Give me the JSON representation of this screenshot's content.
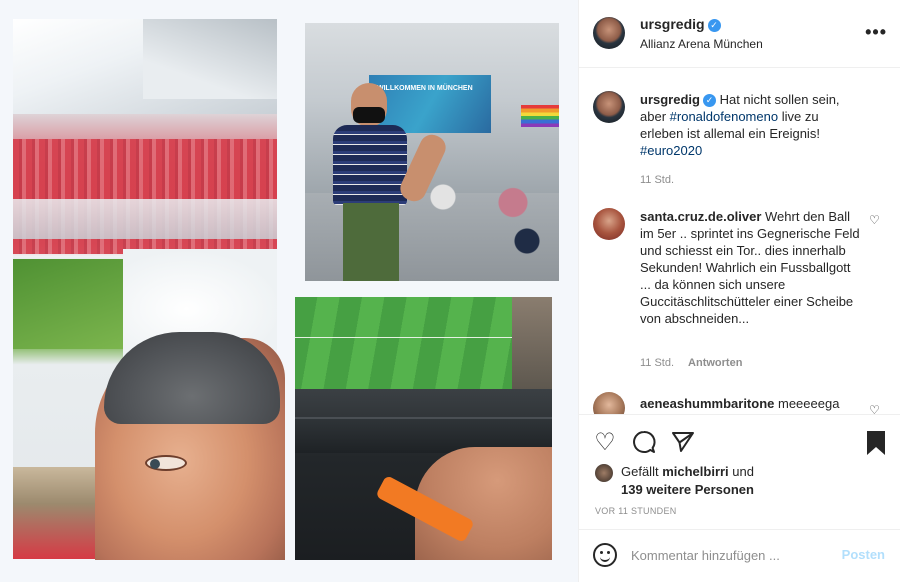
{
  "post": {
    "author": "ursgredig",
    "location": "Allianz Arena München",
    "more_icon": "more-horizontal-icon"
  },
  "caption": {
    "author": "ursgredig",
    "text_before": "Hat nicht sollen sein, aber",
    "mention": "#ronaldofenomeno",
    "text_after": "live zu erleben ist allemal ein Ereignis!",
    "hashtag": "#euro2020",
    "time": "11 Std."
  },
  "comments": [
    {
      "author": "santa.cruz.de.oliver",
      "text": "Wehrt den Ball im 5er .. sprintet ins Gegnerische Feld und schiesst ein Tor.. dies innerhalb Sekunden! Wahrlich ein Fussballgott ... da können sich unsere Guccitäschlitschütteler einer Scheibe von abschneiden...",
      "time": "11 Std.",
      "reply_label": "Antworten"
    },
    {
      "author": "aeneashummbaritone",
      "text": "meeeeega"
    }
  ],
  "actions": {
    "like_icon": "heart-icon",
    "comment_icon": "comment-icon",
    "share_icon": "send-icon",
    "save_icon": "bookmark-icon"
  },
  "likes": {
    "prefix": "Gefällt",
    "user": "michelbirri",
    "connector": "und",
    "count_text": "139 weitere Personen"
  },
  "timestamp": "VOR 11 STUNDEN",
  "add_comment": {
    "placeholder": "Kommentar hinzufügen ...",
    "post_label": "Posten"
  },
  "media": {
    "banner_text": "WILLKOMMEN IN MÜNCHEN"
  },
  "colors": {
    "link": "#00376b",
    "verified": "#3897f0",
    "post_button": "#b2dffc",
    "muted": "#8e8e8e"
  }
}
